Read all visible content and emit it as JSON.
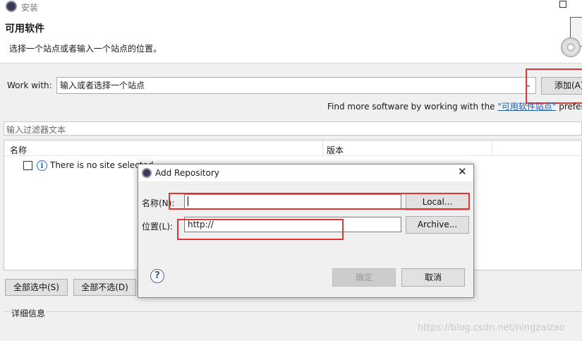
{
  "window": {
    "title": "安装"
  },
  "header": {
    "title": "可用软件",
    "subtitle": "选择一个站点或者输入一个站点的位置。"
  },
  "work_with": {
    "label": "Work with:",
    "value": "输入或者选择一个站点",
    "add_button": "添加(A)",
    "find_more_text": "Find more software by working with the",
    "link_text": "\"可用软件站点\"",
    "suffix": "prefere"
  },
  "filter": {
    "placeholder": "输入过滤器文本"
  },
  "table": {
    "columns": [
      "名称",
      "版本"
    ],
    "rows": [
      {
        "name": "There is no site selected."
      }
    ]
  },
  "buttons": {
    "select_all": "全部选中(S)",
    "deselect_all": "全部不选(D)"
  },
  "details": {
    "label": "详细信息"
  },
  "dialog": {
    "title": "Add Repository",
    "name_label": "名称(N):",
    "name_value": "",
    "location_label": "位置(L):",
    "location_value": "http://",
    "local_button": "Local...",
    "archive_button": "Archive...",
    "ok_button": "确定",
    "cancel_button": "取消"
  },
  "watermark": "https://blog.csdn.net/ningzaizao"
}
